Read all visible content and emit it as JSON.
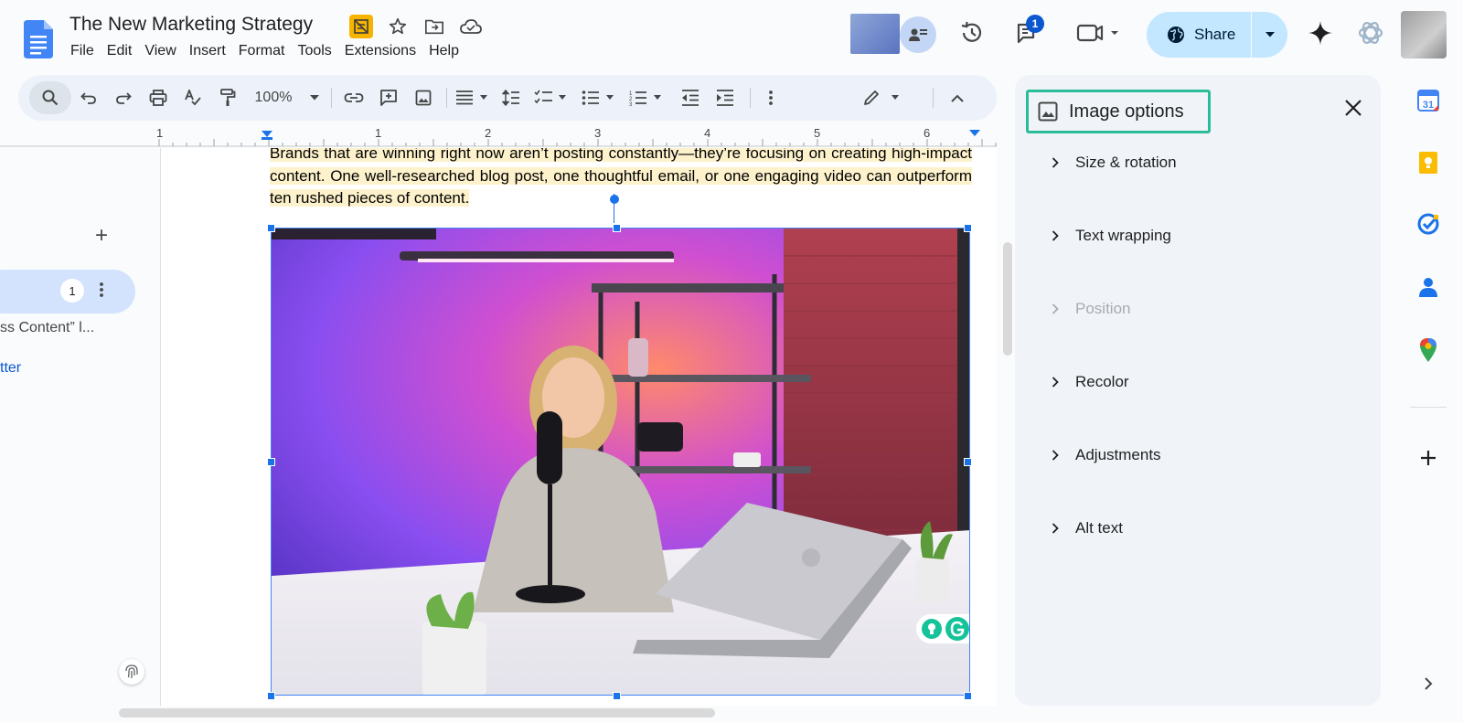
{
  "header": {
    "doc_title": "The New Marketing Strategy",
    "menu": [
      "File",
      "Edit",
      "View",
      "Insert",
      "Format",
      "Tools",
      "Extensions",
      "Help"
    ],
    "notification_count": "1",
    "share_label": "Share"
  },
  "toolbar": {
    "zoom": "100%"
  },
  "ruler": {
    "numbers": [
      "1",
      "1",
      "2",
      "3",
      "4",
      "5",
      "6"
    ]
  },
  "left_pane": {
    "add_symbol": "+",
    "tab_count": "1",
    "outline_item": "ss Content” l...",
    "link_item": "tter"
  },
  "document": {
    "paragraph": "Brands that are winning right now aren’t posting constantly—they’re focusing on creating high-impact content. One well-researched blog post, one thoughtful email, or one engaging video can outperform ten rushed pieces of content."
  },
  "image_panel": {
    "title": "Image options",
    "sections": [
      {
        "label": "Size & rotation",
        "enabled": true
      },
      {
        "label": "Text wrapping",
        "enabled": true
      },
      {
        "label": "Position",
        "enabled": false
      },
      {
        "label": "Recolor",
        "enabled": true
      },
      {
        "label": "Adjustments",
        "enabled": true
      },
      {
        "label": "Alt text",
        "enabled": true
      }
    ]
  },
  "colors": {
    "accent": "#0b57d0",
    "share_bg": "#c2e7ff",
    "highlight": "#fdf2cc",
    "panel_outline": "#2bbd9a"
  }
}
